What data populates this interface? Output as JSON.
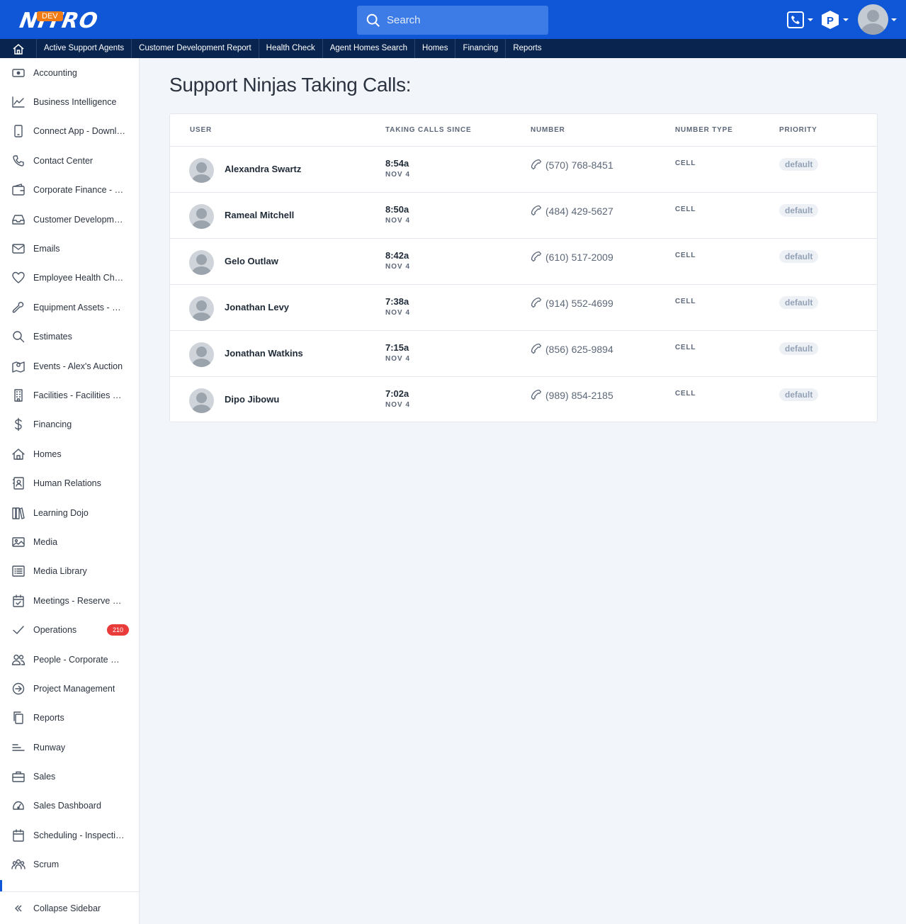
{
  "header": {
    "logo_text": "NITRO",
    "env_badge": "DEV",
    "search_placeholder": "Search"
  },
  "nav": {
    "items": [
      "Active Support Agents",
      "Customer Development Report",
      "Health Check",
      "Agent Homes Search",
      "Homes",
      "Financing",
      "Reports"
    ]
  },
  "sidebar": {
    "items": [
      {
        "label": "Accounting",
        "icon": "money-icon"
      },
      {
        "label": "Business Intelligence",
        "icon": "chart-icon"
      },
      {
        "label": "Connect App - Downloads",
        "icon": "mobile-icon"
      },
      {
        "label": "Contact Center",
        "icon": "phone-icon"
      },
      {
        "label": "Corporate Finance - Cash",
        "icon": "wallet-icon"
      },
      {
        "label": "Customer Development",
        "icon": "inbox-icon"
      },
      {
        "label": "Emails",
        "icon": "envelope-icon"
      },
      {
        "label": "Employee Health Check",
        "icon": "heart-icon"
      },
      {
        "label": "Equipment Assets - Devices",
        "icon": "wrench-icon"
      },
      {
        "label": "Estimates",
        "icon": "search-icon"
      },
      {
        "label": "Events - Alex's Auction",
        "icon": "map-icon"
      },
      {
        "label": "Facilities - Facilities Services",
        "icon": "building-icon"
      },
      {
        "label": "Financing",
        "icon": "dollar-icon"
      },
      {
        "label": "Homes",
        "icon": "home-icon"
      },
      {
        "label": "Human Relations",
        "icon": "contact-book-icon"
      },
      {
        "label": "Learning Dojo",
        "icon": "books-icon"
      },
      {
        "label": "Media",
        "icon": "image-icon"
      },
      {
        "label": "Media Library",
        "icon": "list-icon"
      },
      {
        "label": "Meetings - Reserve a Room",
        "icon": "calendar-check-icon"
      },
      {
        "label": "Operations",
        "icon": "check-icon",
        "badge": "210"
      },
      {
        "label": "People - Corporate Directory",
        "icon": "users-icon"
      },
      {
        "label": "Project Management",
        "icon": "arrow-circle-icon"
      },
      {
        "label": "Reports",
        "icon": "copy-icon"
      },
      {
        "label": "Runway",
        "icon": "runway-icon"
      },
      {
        "label": "Sales",
        "icon": "briefcase-icon"
      },
      {
        "label": "Sales Dashboard",
        "icon": "gauge-icon"
      },
      {
        "label": "Scheduling - Inspections",
        "icon": "calendar-icon"
      },
      {
        "label": "Scrum",
        "icon": "team-icon"
      }
    ],
    "collapse_label": "Collapse Sidebar"
  },
  "main": {
    "title": "Support Ninjas Taking Calls:",
    "columns": [
      "USER",
      "TAKING CALLS SINCE",
      "NUMBER",
      "NUMBER TYPE",
      "PRIORITY"
    ],
    "rows": [
      {
        "name": "Alexandra Swartz",
        "time": "8:54a",
        "date": "NOV 4",
        "number": "(570) 768-8451",
        "type": "CELL",
        "priority": "default"
      },
      {
        "name": "Rameal Mitchell",
        "time": "8:50a",
        "date": "NOV 4",
        "number": "(484) 429-5627",
        "type": "CELL",
        "priority": "default"
      },
      {
        "name": "Gelo Outlaw",
        "time": "8:42a",
        "date": "NOV 4",
        "number": "(610) 517-2009",
        "type": "CELL",
        "priority": "default"
      },
      {
        "name": "Jonathan Levy",
        "time": "7:38a",
        "date": "NOV 4",
        "number": "(914) 552-4699",
        "type": "CELL",
        "priority": "default"
      },
      {
        "name": "Jonathan Watkins",
        "time": "7:15a",
        "date": "NOV 4",
        "number": "(856) 625-9894",
        "type": "CELL",
        "priority": "default"
      },
      {
        "name": "Dipo Jibowu",
        "time": "7:02a",
        "date": "NOV 4",
        "number": "(989) 854-2185",
        "type": "CELL",
        "priority": "default"
      }
    ]
  },
  "colors": {
    "brand_blue": "#0f57d6",
    "nav_dark": "#09254f",
    "badge_red": "#ea3b3b",
    "dev_orange": "#f07a14"
  }
}
